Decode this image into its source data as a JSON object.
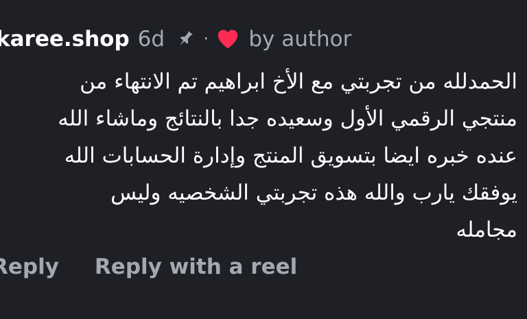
{
  "comment": {
    "username": "karee.shop",
    "time_ago": "6d",
    "separator": "·",
    "by_author": "by author",
    "body_lines": [
      "الحمدلله من تجربتي مع الأخ ابراهيم تم الانتهاء من",
      "منتجي الرقمي الأول وسعيده جدا بالنتائج وماشاء الله",
      "عنده خبره ايضا بتسويق المنتج وإدارة الحسابات الله",
      "يوفقك يارب والله هذه تجربتي الشخصيه وليس",
      "مجامله"
    ],
    "icons": {
      "pin": "pin-icon",
      "heart": "heart-icon"
    },
    "heart_color": "#fe2c55"
  },
  "actions": {
    "reply_label": "Reply",
    "reel_label": "Reply with a reel"
  }
}
